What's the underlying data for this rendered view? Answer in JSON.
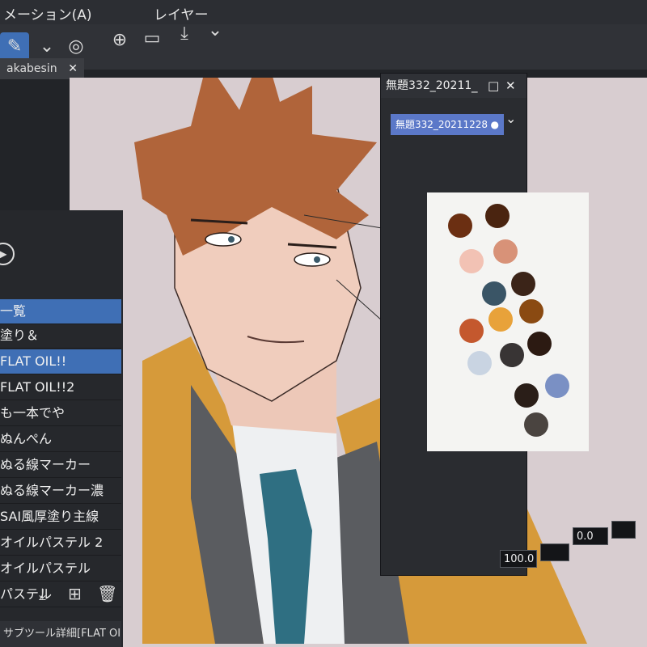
{
  "menu": {
    "items": [
      "メーション(A)",
      "レイヤー"
    ]
  },
  "document": {
    "tab_label": "akabesin",
    "close_symbol": "✕"
  },
  "brush_panel": {
    "header": "一覧",
    "items": [
      "塗り＆",
      "FLAT OIL!!",
      "FLAT OIL!!2",
      "も一本でや",
      "ぬんぺん",
      "ぬる線マーカー",
      "ぬる線マーカー濃",
      "SAI風厚塗り主線",
      "オイルパステル 2",
      "オイルパステル",
      "パステル"
    ],
    "selected_index": 1,
    "footer_label": "サブツール詳細[FLAT OIL!!]"
  },
  "color_panel": {
    "title": "無題332_20211",
    "set_name": "無題332_20211228",
    "opacity_value": "100.0",
    "angle_value": "0.0",
    "swatches": [
      {
        "color": "#6b2f12"
      },
      {
        "color": "#4a2410"
      },
      {
        "color": "#f2c2b4"
      },
      {
        "color": "#d89278"
      },
      {
        "color": "#3a5566"
      },
      {
        "color": "#3b2418"
      },
      {
        "color": "#e8a23a"
      },
      {
        "color": "#8a4a12"
      },
      {
        "color": "#c4582e"
      },
      {
        "color": "#c9d4e2"
      },
      {
        "color": "#383434"
      },
      {
        "color": "#2c1a12"
      },
      {
        "color": "#2a1e18"
      },
      {
        "color": "#7a90c4"
      },
      {
        "color": "#4a4440"
      }
    ]
  },
  "colors": {
    "accent": "#3f6fb5",
    "set_highlight": "#5b78c8",
    "canvas_bg": "#d8cdd0"
  }
}
